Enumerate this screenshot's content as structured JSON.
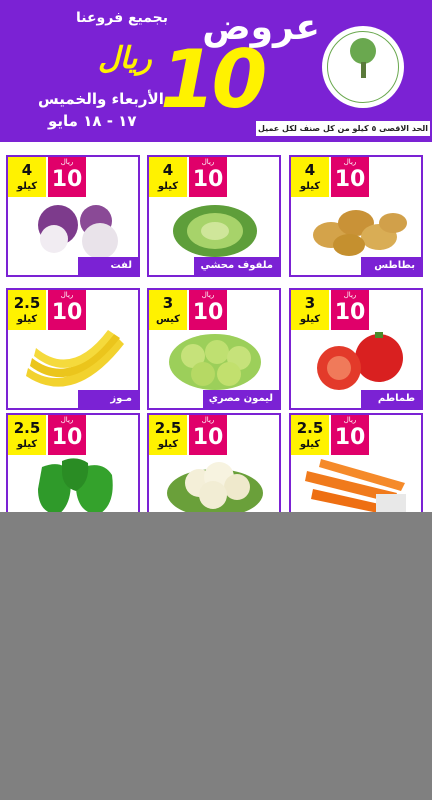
{
  "header": {
    "offers_title": "عروض",
    "price_big": "10",
    "currency_big": "ريال",
    "branches": "بجميع فروعنا",
    "days": "الأربعاء والخميس",
    "dates": "١٧ - ١٨ مايو",
    "limit_notice": "الحد الاقصى ٥ كيلو من كل صنف لكل عميل"
  },
  "colors": {
    "purple": "#7b22d4",
    "yellow": "#fff200",
    "magenta": "#e0006a",
    "lower_gray": "#808080"
  },
  "products": [
    {
      "name": "بطاطس",
      "qty": "4",
      "unit": "كيلو",
      "price": "10",
      "currency": "ريال",
      "icon": "potatoes-image"
    },
    {
      "name": "ملفوف محشي",
      "qty": "4",
      "unit": "كيلو",
      "price": "10",
      "currency": "ريال",
      "icon": "cabbage-image"
    },
    {
      "name": "لفت",
      "qty": "4",
      "unit": "كيلو",
      "price": "10",
      "currency": "ريال",
      "icon": "turnips-image"
    },
    {
      "name": "طماطم",
      "qty": "3",
      "unit": "كيلو",
      "price": "10",
      "currency": "ريال",
      "icon": "tomatoes-image"
    },
    {
      "name": "ليمون مصري",
      "qty": "3",
      "unit": "كيس",
      "price": "10",
      "currency": "ريال",
      "icon": "lemons-image"
    },
    {
      "name": "مـوز",
      "qty": "2.5",
      "unit": "كيلو",
      "price": "10",
      "currency": "ريال",
      "icon": "bananas-image"
    },
    {
      "name": "",
      "qty": "2.5",
      "unit": "كيلو",
      "price": "10",
      "currency": "ريال",
      "icon": "carrots-image"
    },
    {
      "name": "",
      "qty": "2.5",
      "unit": "كيلو",
      "price": "10",
      "currency": "ريال",
      "icon": "cauliflower-image"
    },
    {
      "name": "",
      "qty": "2.5",
      "unit": "كيلو",
      "price": "10",
      "currency": "ريال",
      "icon": "green-peppers-image"
    }
  ]
}
